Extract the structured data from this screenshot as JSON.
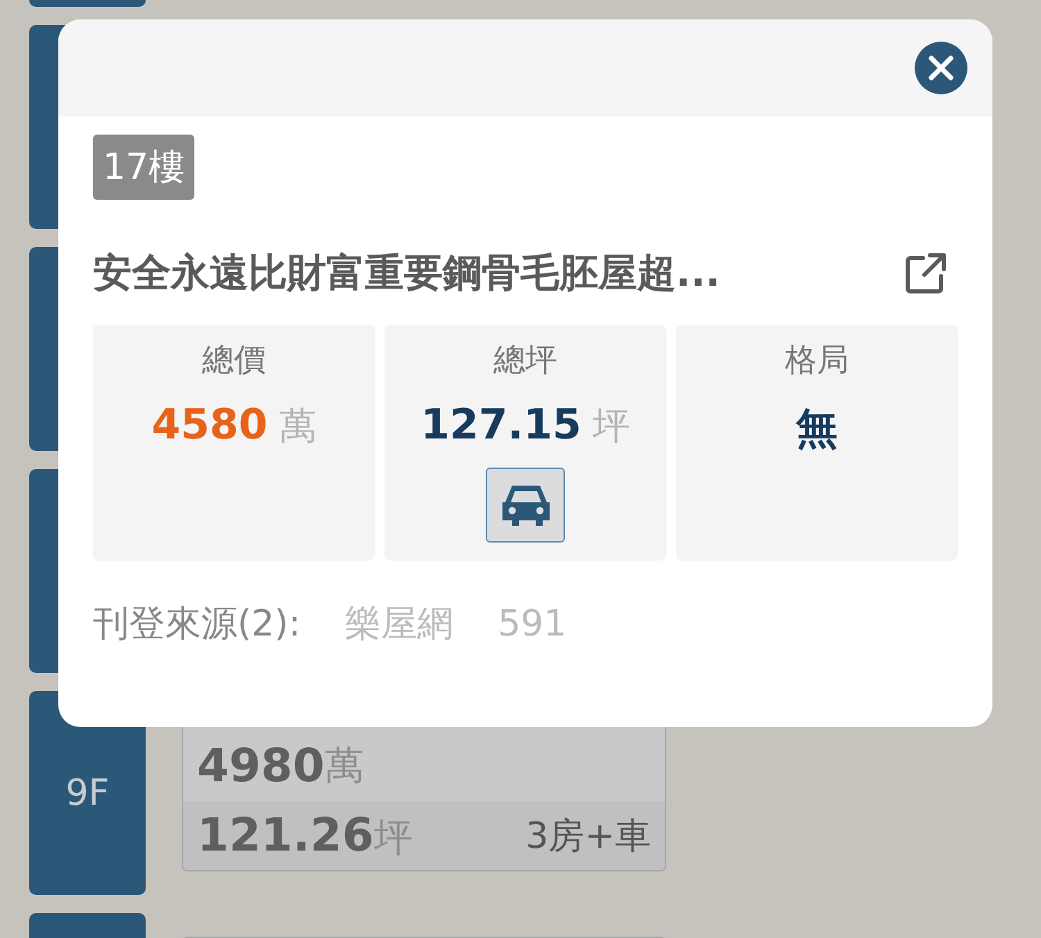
{
  "floors": [
    {
      "kind": "covered"
    },
    {
      "kind": "covered"
    },
    {
      "kind": "covered"
    },
    {
      "kind": "covered"
    },
    {
      "kind": "shown",
      "label": "9F",
      "listing": {
        "price": "4980",
        "price_unit": "萬",
        "area": "121.26",
        "area_unit": "坪",
        "layout": "3房+車"
      }
    },
    {
      "kind": "cut"
    }
  ],
  "dialog": {
    "floor_badge": "17樓",
    "title": "安全永遠比財富重要鋼骨毛胚屋超...",
    "stats": [
      {
        "label": "總價",
        "value": "4580",
        "unit": "萬",
        "kind": "price",
        "parking": false
      },
      {
        "label": "總坪",
        "value": "127.15",
        "unit": "坪",
        "kind": "area",
        "parking": true
      },
      {
        "label": "格局",
        "value": "無",
        "kind": "layout",
        "parking": false
      }
    ],
    "sources": {
      "label": "刊登來源(2):",
      "items": [
        "樂屋網",
        "591"
      ]
    }
  }
}
